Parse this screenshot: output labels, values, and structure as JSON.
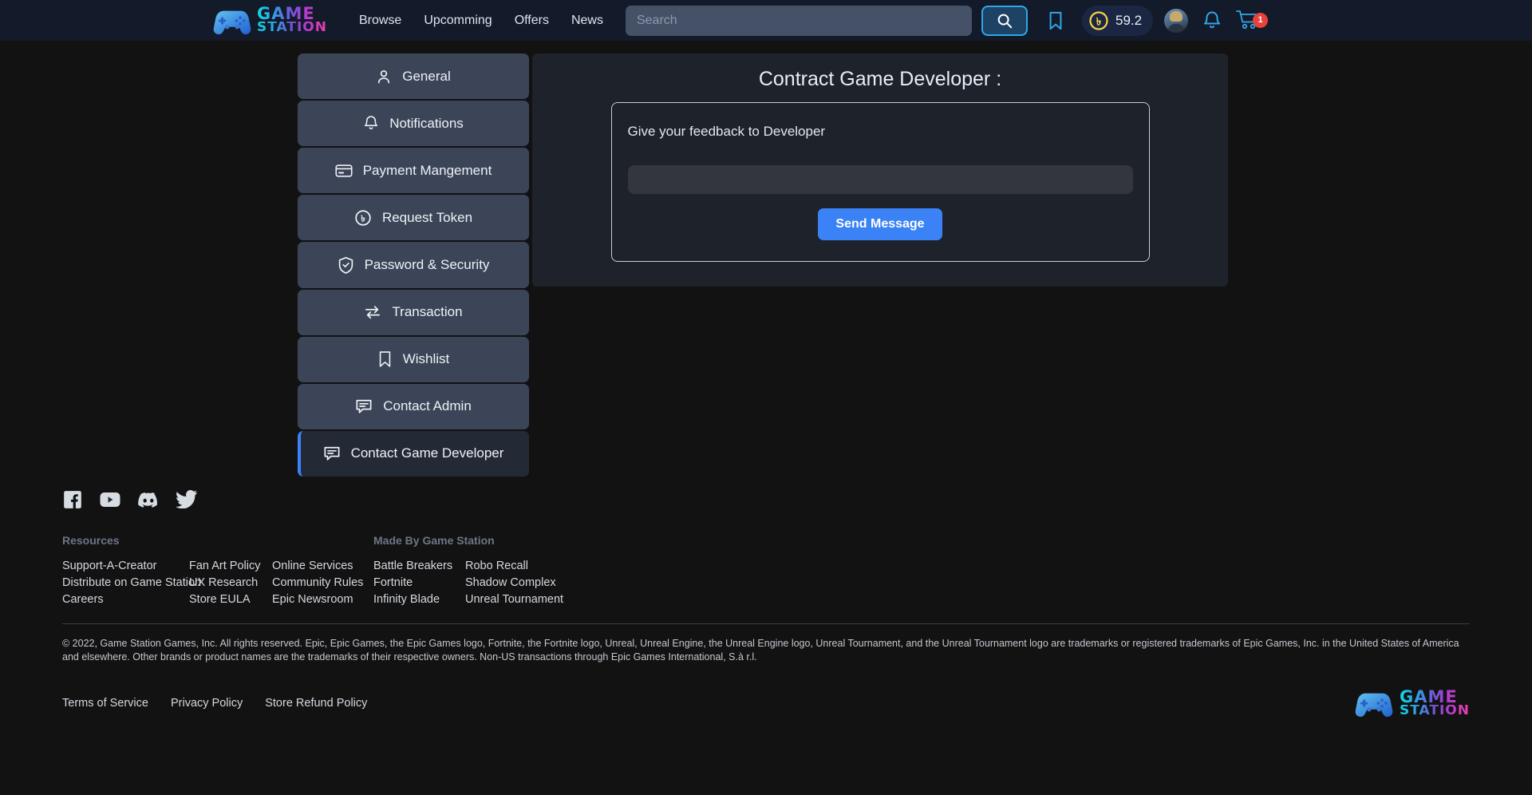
{
  "header": {
    "brand": {
      "name_line1": "GAME",
      "name_line2": "STATION",
      "icon": "gamepad-icon"
    },
    "nav": [
      {
        "label": "Browse"
      },
      {
        "label": "Upcomming"
      },
      {
        "label": "Offers"
      },
      {
        "label": "News"
      }
    ],
    "search": {
      "placeholder": "Search",
      "value": "",
      "icon": "search-icon"
    },
    "bookmark_icon": "bookmark-icon",
    "balance": {
      "currency_symbol": "৳",
      "amount": "59.2"
    },
    "avatar": "user-avatar",
    "notification_icon": "bell-icon",
    "cart": {
      "icon": "cart-icon",
      "badge": "1"
    }
  },
  "sidebar": {
    "items": [
      {
        "label": "General",
        "icon": "user-icon",
        "active": false
      },
      {
        "label": "Notifications",
        "icon": "bell-icon",
        "active": false
      },
      {
        "label": "Payment Mangement",
        "icon": "credit-card-icon",
        "active": false
      },
      {
        "label": "Request Token",
        "icon": "taka-coin-icon",
        "active": false
      },
      {
        "label": "Password & Security",
        "icon": "shield-check-icon",
        "active": false
      },
      {
        "label": "Transaction",
        "icon": "transfer-arrows-icon",
        "active": false
      },
      {
        "label": "Wishlist",
        "icon": "bookmark-icon",
        "active": false
      },
      {
        "label": "Contact Admin",
        "icon": "chat-bubble-icon",
        "active": false
      },
      {
        "label": "Contact Game Developer",
        "icon": "chat-bubble-icon",
        "active": true
      }
    ]
  },
  "main": {
    "title": "Contract Game Developer :",
    "feedback_label": "Give your feedback to Developer",
    "feedback_placeholder": "",
    "feedback_value": "",
    "send_button": "Send Message"
  },
  "footer": {
    "socials": [
      {
        "name": "facebook-icon"
      },
      {
        "name": "youtube-icon"
      },
      {
        "name": "discord-icon"
      },
      {
        "name": "twitter-icon"
      }
    ],
    "groups": [
      {
        "title": "Resources",
        "columns": [
          [
            "Support-A-Creator",
            "Distribute on Game Station",
            "Careers"
          ],
          [
            "Fan Art Policy",
            "UX Research",
            "Store EULA"
          ],
          [
            "Online Services",
            "Community Rules",
            "Epic Newsroom"
          ]
        ]
      },
      {
        "title": "Made By Game Station",
        "columns": [
          [
            "Battle Breakers",
            "Fortnite",
            "Infinity Blade"
          ],
          [
            "Robo Recall",
            "Shadow Complex",
            "Unreal Tournament"
          ]
        ]
      }
    ],
    "copyright": "© 2022, Game Station Games, Inc. All rights reserved. Epic, Epic Games, the Epic Games logo, Fortnite, the Fortnite logo, Unreal, Unreal Engine, the Unreal Engine logo, Unreal Tournament, and the Unreal Tournament logo are trademarks or registered trademarks of Epic Games, Inc. in the United States of America and elsewhere. Other brands or product names are the trademarks of their respective owners. Non-US transactions through Epic Games International, S.à r.l.",
    "legal_links": [
      {
        "label": "Terms of Service"
      },
      {
        "label": "Privacy Policy"
      },
      {
        "label": "Store Refund Policy"
      }
    ],
    "brand": {
      "name_line1": "GAME",
      "name_line2": "STATION",
      "icon": "gamepad-icon"
    }
  },
  "colors": {
    "header_bg": "#131a2a",
    "page_bg": "#121212",
    "accent_blue": "#3b82f6",
    "search_border": "#2fa8e8",
    "badge_red": "#e8403a",
    "coin_yellow": "#f5d547",
    "sidebar_item": "#3c4558"
  }
}
